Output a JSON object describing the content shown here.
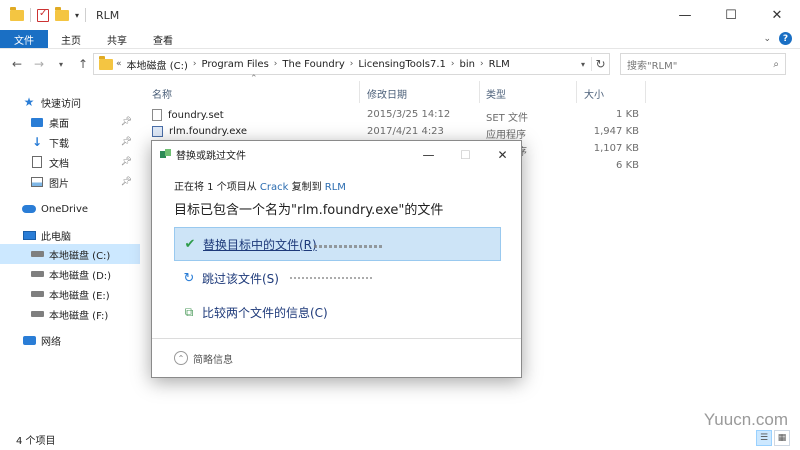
{
  "window": {
    "title": "RLM",
    "minimize": "—",
    "maximize": "☐",
    "close": "✕"
  },
  "ribbon": {
    "tabs": [
      "文件",
      "主页",
      "共享",
      "查看"
    ],
    "help": "?"
  },
  "address": {
    "segments": [
      "本地磁盘 (C:)",
      "Program Files",
      "The Foundry",
      "LicensingTools7.1",
      "bin",
      "RLM"
    ],
    "search_placeholder": "搜索\"RLM\""
  },
  "sidebar": {
    "items": [
      {
        "label": "快速访问",
        "icon": "star-icon"
      },
      {
        "label": "桌面",
        "icon": "desktop-icon",
        "pinned": true
      },
      {
        "label": "下载",
        "icon": "download-icon",
        "pinned": true
      },
      {
        "label": "文档",
        "icon": "document-icon",
        "pinned": true
      },
      {
        "label": "图片",
        "icon": "pictures-icon",
        "pinned": true
      },
      {
        "label": "OneDrive",
        "icon": "cloud-icon"
      },
      {
        "label": "此电脑",
        "icon": "computer-icon"
      },
      {
        "label": "本地磁盘 (C:)",
        "icon": "drive-icon",
        "selected": true
      },
      {
        "label": "本地磁盘 (D:)",
        "icon": "drive-icon"
      },
      {
        "label": "本地磁盘 (E:)",
        "icon": "drive-icon"
      },
      {
        "label": "本地磁盘 (F:)",
        "icon": "drive-icon"
      },
      {
        "label": "网络",
        "icon": "network-icon"
      }
    ]
  },
  "filelist": {
    "columns": [
      "名称",
      "修改日期",
      "类型",
      "大小"
    ],
    "rows": [
      {
        "name": "foundry.set",
        "date": "2015/3/25 14:12",
        "type": "SET 文件",
        "size": "1 KB",
        "icon": "file-icon"
      },
      {
        "name": "rlm.foundry.exe",
        "date": "2017/4/21 4:23",
        "type": "应用程序",
        "size": "1,947 KB",
        "icon": "exe-icon"
      },
      {
        "name": "",
        "date": "",
        "type": "序",
        "size": "1,107 KB",
        "icon": ""
      },
      {
        "name": "",
        "date": "",
        "type": "",
        "size": "6 KB",
        "icon": ""
      }
    ]
  },
  "status": {
    "count": "4 个项目"
  },
  "dialog": {
    "title": "替换或跳过文件",
    "copy_prefix": "正在将 1 个项目从 ",
    "copy_source": "Crack",
    "copy_middle": " 复制到 ",
    "copy_dest": "RLM",
    "heading": "目标已包含一个名为\"rlm.foundry.exe\"的文件",
    "options": [
      {
        "label": "替换目标中的文件(R)",
        "icon": "check-icon"
      },
      {
        "label": "跳过该文件(S)",
        "icon": "skip-icon"
      },
      {
        "label": "比较两个文件的信息(C)",
        "icon": "compare-icon"
      }
    ],
    "details": "简略信息"
  },
  "watermark": "Yuucn.com"
}
